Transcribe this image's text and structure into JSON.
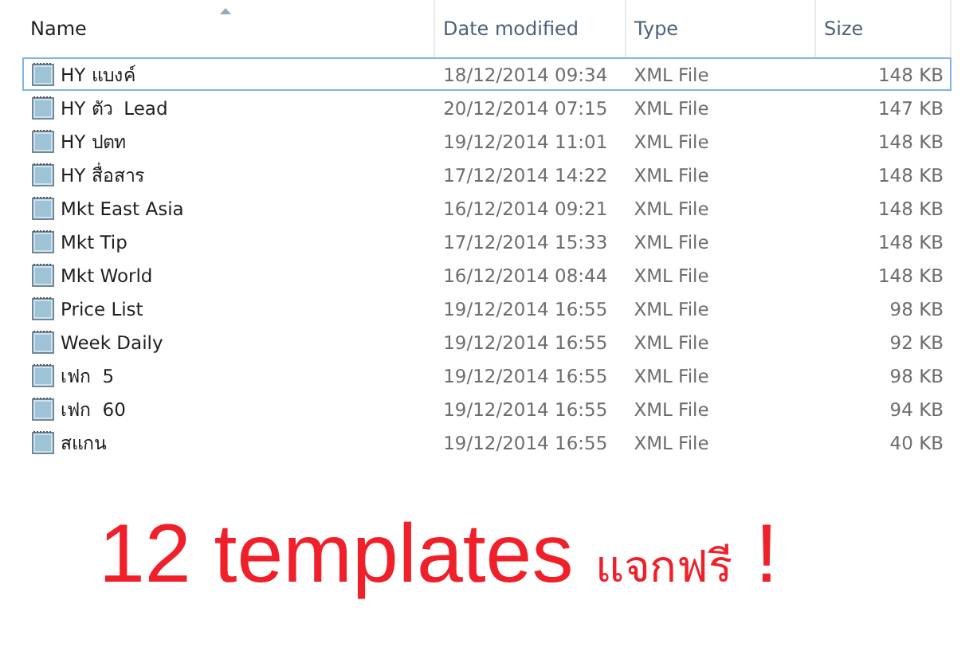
{
  "table": {
    "columns": [
      {
        "label": "Name",
        "sorted": true
      },
      {
        "label": "Date modified",
        "sorted": false
      },
      {
        "label": "Type",
        "sorted": false
      },
      {
        "label": "Size",
        "sorted": false
      }
    ],
    "rows": [
      {
        "name": "HY แบงค์",
        "date": "18/12/2014 09:34",
        "type": "XML File",
        "size": "148 KB",
        "selected": true
      },
      {
        "name": "HY ตัว  Lead",
        "date": "20/12/2014 07:15",
        "type": "XML File",
        "size": "147 KB",
        "selected": false
      },
      {
        "name": "HY ปตท",
        "date": "19/12/2014 11:01",
        "type": "XML File",
        "size": "148 KB",
        "selected": false
      },
      {
        "name": "HY สื่อสาร",
        "date": "17/12/2014 14:22",
        "type": "XML File",
        "size": "148 KB",
        "selected": false
      },
      {
        "name": "Mkt East Asia",
        "date": "16/12/2014 09:21",
        "type": "XML File",
        "size": "148 KB",
        "selected": false
      },
      {
        "name": "Mkt Tip",
        "date": "17/12/2014 15:33",
        "type": "XML File",
        "size": "148 KB",
        "selected": false
      },
      {
        "name": "Mkt World",
        "date": "16/12/2014 08:44",
        "type": "XML File",
        "size": "148 KB",
        "selected": false
      },
      {
        "name": "Price List",
        "date": "19/12/2014 16:55",
        "type": "XML File",
        "size": "98 KB",
        "selected": false
      },
      {
        "name": "Week Daily",
        "date": "19/12/2014 16:55",
        "type": "XML File",
        "size": "92 KB",
        "selected": false
      },
      {
        "name": "เฟก  5",
        "date": "19/12/2014 16:55",
        "type": "XML File",
        "size": "98 KB",
        "selected": false
      },
      {
        "name": "เฟก  60",
        "date": "19/12/2014 16:55",
        "type": "XML File",
        "size": "94 KB",
        "selected": false
      },
      {
        "name": "สแกน",
        "date": "19/12/2014 16:55",
        "type": "XML File",
        "size": "40 KB",
        "selected": false
      }
    ]
  },
  "caption": {
    "count": "12 templates",
    "thai": "แจกฟรี",
    "mark": "!"
  }
}
